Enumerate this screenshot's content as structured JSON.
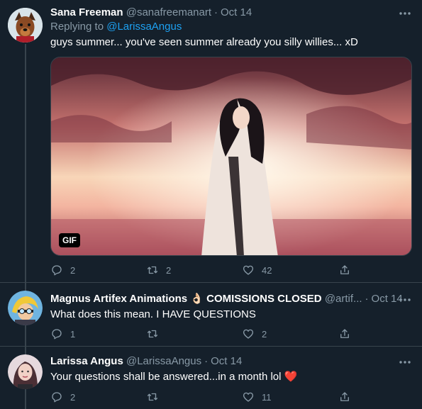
{
  "tweets": [
    {
      "name": "Sana Freeman",
      "handle": "@sanafreemanart",
      "date": "Oct 14",
      "replying_label": "Replying to",
      "replying_to": "@LarissaAngus",
      "text": "guys summer... you've seen summer already you silly willies... xD",
      "media_badge": "GIF",
      "replies": "2",
      "retweets": "2",
      "likes": "42"
    },
    {
      "name": "Magnus Artifex Animations",
      "name_emoji": "👌🏻",
      "name_suffix": "COMISSIONS CLOSED",
      "handle": "@artif...",
      "date": "Oct 14",
      "text": "What does this mean. I HAVE QUESTIONS",
      "replies": "1",
      "retweets": "",
      "likes": "2"
    },
    {
      "name": "Larissa Angus",
      "handle": "@LarissaAngus",
      "date": "Oct 14",
      "text": "Your questions shall be answered...in a month lol",
      "text_emoji": "❤️",
      "replies": "2",
      "retweets": "",
      "likes": "11"
    }
  ],
  "icons": {
    "reply": "reply-icon",
    "retweet": "retweet-icon",
    "like": "heart-icon",
    "share": "share-icon",
    "more": "more-icon"
  },
  "colors": {
    "background": "#15202b",
    "muted": "#8899a6",
    "link": "#1da1f2",
    "heart_emoji": "#e0245e"
  }
}
